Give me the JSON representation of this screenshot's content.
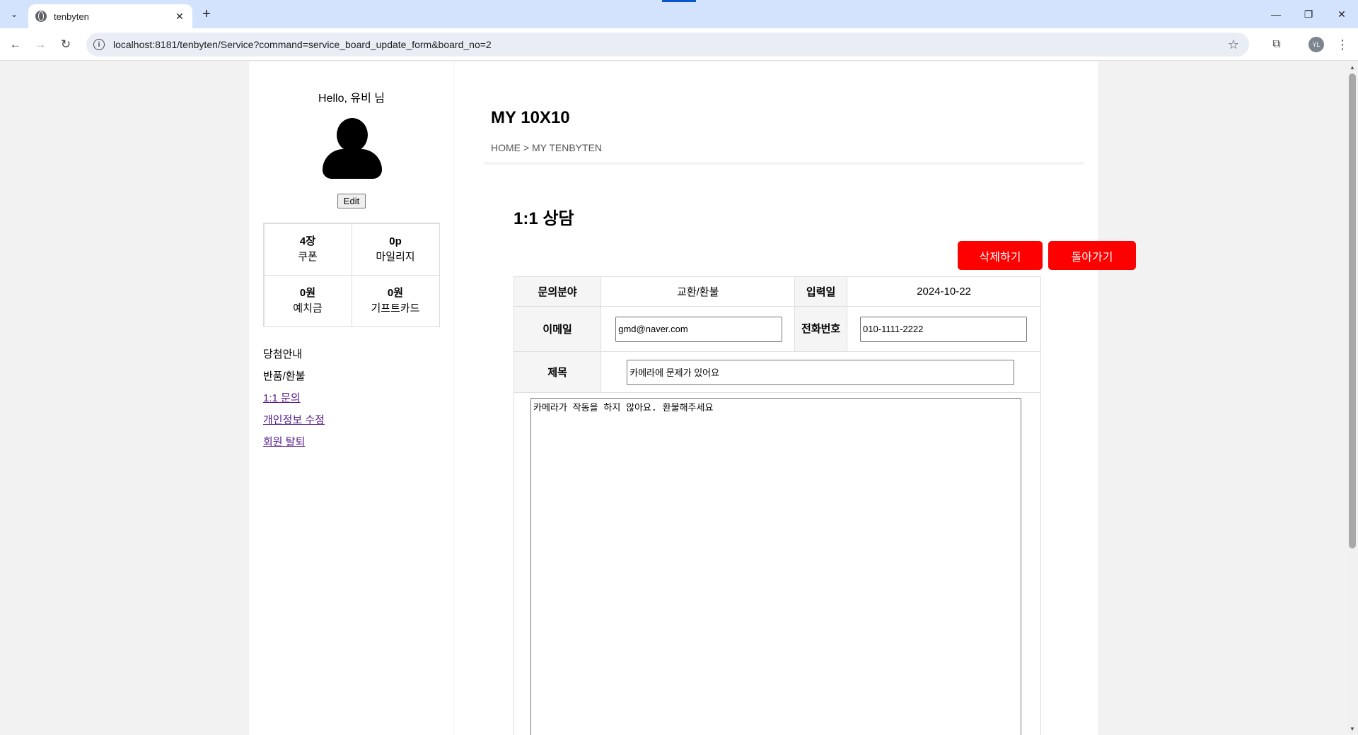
{
  "browser": {
    "tab_title": "tenbyten",
    "url": "localhost:8181/tenbyten/Service?command=service_board_update_form&board_no=2",
    "profile_initials": "YL"
  },
  "sidebar": {
    "greeting": "Hello, 유비 님",
    "edit_label": "Edit",
    "stats": [
      {
        "value": "4장",
        "label": "쿠폰"
      },
      {
        "value": "0p",
        "label": "마일리지"
      },
      {
        "value": "0원",
        "label": "예치금"
      },
      {
        "value": "0원",
        "label": "기프트카드"
      }
    ],
    "menu": [
      {
        "label": "당첨안내"
      },
      {
        "label": "반품/환불"
      },
      {
        "label": "1:1 문의"
      },
      {
        "label": "개인정보 수정"
      },
      {
        "label": "회원 탈퇴"
      }
    ]
  },
  "main": {
    "page_title": "MY 10X10",
    "breadcrumb": "HOME > MY TENBYTEN",
    "section_title": "1:1 상담",
    "delete_label": "삭제하기",
    "back_label": "돌아가기",
    "accent_color": "#ff0000",
    "form": {
      "category_label": "문의분야",
      "category_value": "교환/환불",
      "date_label": "입력일",
      "date_value": "2024-10-22",
      "email_label": "이메일",
      "email_value": "gmd@naver.com",
      "phone_label": "전화번호",
      "phone_value": "010-1111-2222",
      "subject_label": "제목",
      "subject_value": "카메라에 문제가 있어요",
      "content_value": "카메라가 작동을 하지 않아요. 환불해주세요"
    }
  }
}
